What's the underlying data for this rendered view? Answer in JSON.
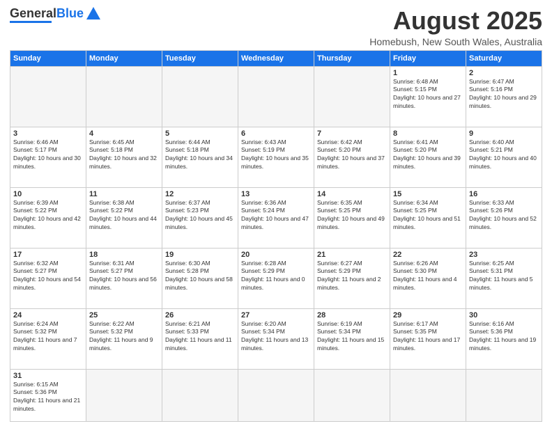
{
  "header": {
    "logo_general": "General",
    "logo_blue": "Blue",
    "month_title": "August 2025",
    "location": "Homebush, New South Wales, Australia"
  },
  "weekdays": [
    "Sunday",
    "Monday",
    "Tuesday",
    "Wednesday",
    "Thursday",
    "Friday",
    "Saturday"
  ],
  "weeks": [
    [
      {
        "day": "",
        "empty": true
      },
      {
        "day": "",
        "empty": true
      },
      {
        "day": "",
        "empty": true
      },
      {
        "day": "",
        "empty": true
      },
      {
        "day": "",
        "empty": true
      },
      {
        "day": "1",
        "sunrise": "6:48 AM",
        "sunset": "5:15 PM",
        "daylight": "10 hours and 27 minutes."
      },
      {
        "day": "2",
        "sunrise": "6:47 AM",
        "sunset": "5:16 PM",
        "daylight": "10 hours and 29 minutes."
      }
    ],
    [
      {
        "day": "3",
        "sunrise": "6:46 AM",
        "sunset": "5:17 PM",
        "daylight": "10 hours and 30 minutes."
      },
      {
        "day": "4",
        "sunrise": "6:45 AM",
        "sunset": "5:18 PM",
        "daylight": "10 hours and 32 minutes."
      },
      {
        "day": "5",
        "sunrise": "6:44 AM",
        "sunset": "5:18 PM",
        "daylight": "10 hours and 34 minutes."
      },
      {
        "day": "6",
        "sunrise": "6:43 AM",
        "sunset": "5:19 PM",
        "daylight": "10 hours and 35 minutes."
      },
      {
        "day": "7",
        "sunrise": "6:42 AM",
        "sunset": "5:20 PM",
        "daylight": "10 hours and 37 minutes."
      },
      {
        "day": "8",
        "sunrise": "6:41 AM",
        "sunset": "5:20 PM",
        "daylight": "10 hours and 39 minutes."
      },
      {
        "day": "9",
        "sunrise": "6:40 AM",
        "sunset": "5:21 PM",
        "daylight": "10 hours and 40 minutes."
      }
    ],
    [
      {
        "day": "10",
        "sunrise": "6:39 AM",
        "sunset": "5:22 PM",
        "daylight": "10 hours and 42 minutes."
      },
      {
        "day": "11",
        "sunrise": "6:38 AM",
        "sunset": "5:22 PM",
        "daylight": "10 hours and 44 minutes."
      },
      {
        "day": "12",
        "sunrise": "6:37 AM",
        "sunset": "5:23 PM",
        "daylight": "10 hours and 45 minutes."
      },
      {
        "day": "13",
        "sunrise": "6:36 AM",
        "sunset": "5:24 PM",
        "daylight": "10 hours and 47 minutes."
      },
      {
        "day": "14",
        "sunrise": "6:35 AM",
        "sunset": "5:25 PM",
        "daylight": "10 hours and 49 minutes."
      },
      {
        "day": "15",
        "sunrise": "6:34 AM",
        "sunset": "5:25 PM",
        "daylight": "10 hours and 51 minutes."
      },
      {
        "day": "16",
        "sunrise": "6:33 AM",
        "sunset": "5:26 PM",
        "daylight": "10 hours and 52 minutes."
      }
    ],
    [
      {
        "day": "17",
        "sunrise": "6:32 AM",
        "sunset": "5:27 PM",
        "daylight": "10 hours and 54 minutes."
      },
      {
        "day": "18",
        "sunrise": "6:31 AM",
        "sunset": "5:27 PM",
        "daylight": "10 hours and 56 minutes."
      },
      {
        "day": "19",
        "sunrise": "6:30 AM",
        "sunset": "5:28 PM",
        "daylight": "10 hours and 58 minutes."
      },
      {
        "day": "20",
        "sunrise": "6:28 AM",
        "sunset": "5:29 PM",
        "daylight": "11 hours and 0 minutes."
      },
      {
        "day": "21",
        "sunrise": "6:27 AM",
        "sunset": "5:29 PM",
        "daylight": "11 hours and 2 minutes."
      },
      {
        "day": "22",
        "sunrise": "6:26 AM",
        "sunset": "5:30 PM",
        "daylight": "11 hours and 4 minutes."
      },
      {
        "day": "23",
        "sunrise": "6:25 AM",
        "sunset": "5:31 PM",
        "daylight": "11 hours and 5 minutes."
      }
    ],
    [
      {
        "day": "24",
        "sunrise": "6:24 AM",
        "sunset": "5:32 PM",
        "daylight": "11 hours and 7 minutes."
      },
      {
        "day": "25",
        "sunrise": "6:22 AM",
        "sunset": "5:32 PM",
        "daylight": "11 hours and 9 minutes."
      },
      {
        "day": "26",
        "sunrise": "6:21 AM",
        "sunset": "5:33 PM",
        "daylight": "11 hours and 11 minutes."
      },
      {
        "day": "27",
        "sunrise": "6:20 AM",
        "sunset": "5:34 PM",
        "daylight": "11 hours and 13 minutes."
      },
      {
        "day": "28",
        "sunrise": "6:19 AM",
        "sunset": "5:34 PM",
        "daylight": "11 hours and 15 minutes."
      },
      {
        "day": "29",
        "sunrise": "6:17 AM",
        "sunset": "5:35 PM",
        "daylight": "11 hours and 17 minutes."
      },
      {
        "day": "30",
        "sunrise": "6:16 AM",
        "sunset": "5:36 PM",
        "daylight": "11 hours and 19 minutes."
      }
    ],
    [
      {
        "day": "31",
        "sunrise": "6:15 AM",
        "sunset": "5:36 PM",
        "daylight": "11 hours and 21 minutes."
      },
      {
        "day": "",
        "empty": true
      },
      {
        "day": "",
        "empty": true
      },
      {
        "day": "",
        "empty": true
      },
      {
        "day": "",
        "empty": true
      },
      {
        "day": "",
        "empty": true
      },
      {
        "day": "",
        "empty": true
      }
    ]
  ]
}
